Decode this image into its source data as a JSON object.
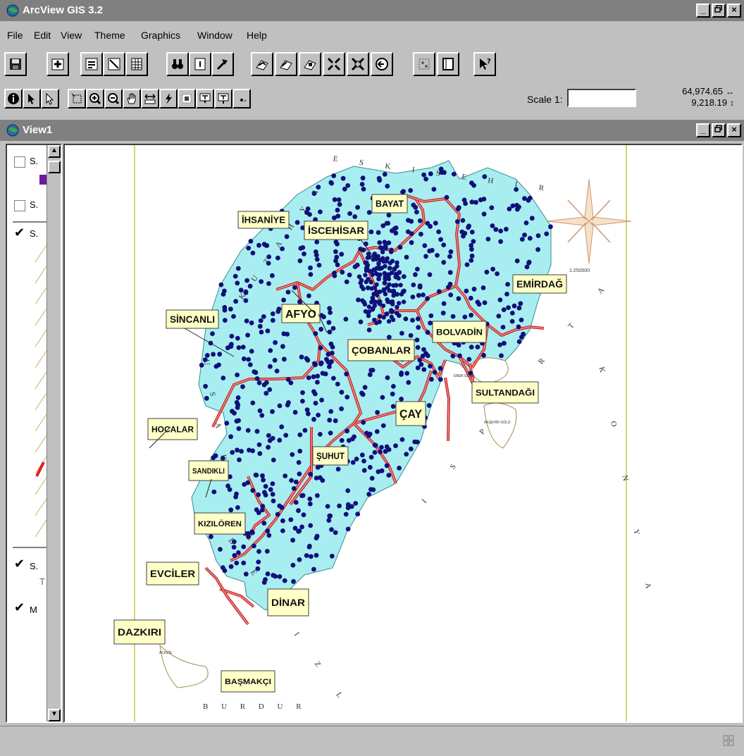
{
  "app": {
    "title": "ArcView GIS 3.2"
  },
  "menu": [
    "File",
    "Edit",
    "View",
    "Theme",
    "Graphics",
    "Window",
    "Help"
  ],
  "window_controls": {
    "minimize": "_",
    "restore": " ",
    "close": "×"
  },
  "toolbar": {
    "scale_label": "Scale 1:",
    "scale_value": "",
    "x_coord": "64,974.65",
    "y_coord": "9,218.19",
    "x_arrow": "↔",
    "y_arrow": "↕"
  },
  "view": {
    "title": "View1"
  },
  "toc": {
    "items": [
      {
        "label": "S.",
        "checked": false
      },
      {
        "label": "S.",
        "checked": false
      },
      {
        "label": "S.",
        "checked": true
      },
      {
        "label": "S.",
        "checked": true,
        "sub": "T"
      },
      {
        "label": "M",
        "checked": true
      }
    ]
  },
  "map": {
    "labels": {
      "ihsaniye": "İHSANİYE",
      "bayat": "BAYAT",
      "iscehisar": "İSCEHİSAR",
      "emirdag": "EMİRDAĞ",
      "sincanli": "SİNCANLI",
      "afyon": "AFYO",
      "bolvadin": "BOLVADİN",
      "cobanlar": "ÇOBANLAR",
      "sultandagi": "SULTANDAĞI",
      "cay": "ÇAY",
      "hocalar": "HOCALAR",
      "suhut": "ŞUHUT",
      "sandikli": "SANDIKLI",
      "kiziloren": "KIZILÖREN",
      "evciler": "EVCİLER",
      "dinar": "DİNAR",
      "dazkiri": "DAZKIRI",
      "basmakci": "BAŞMAKÇI"
    },
    "boundary_letters": {
      "eskisehir": "E S K I S E H I R",
      "kutahya": "K U T A H Y A",
      "usak": "U S A K",
      "denizli": "D E N I Z L I",
      "isparta": "I S P A R T A",
      "burdur": "B U R D U R",
      "konya": "K O N Y A"
    },
    "scale_note": "1:250000",
    "lake_names": {
      "eber": "EBER GÖLÜ",
      "aksehir": "AKŞEHİR GÖLÜ",
      "acigol": "ACIGÖL"
    },
    "colors": {
      "province_fill": "#a8eef0",
      "roads": "#cc2a2a",
      "points": "#10107a",
      "label_bg": "#ffffc8",
      "frame_line": "#c8c840"
    }
  }
}
